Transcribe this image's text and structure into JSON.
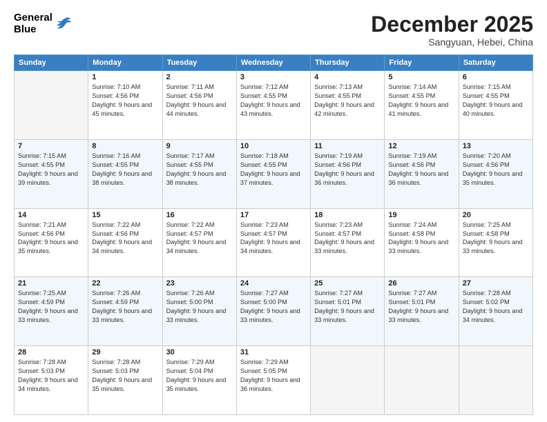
{
  "header": {
    "logo": {
      "general": "General",
      "blue": "Blue"
    },
    "title": "December 2025",
    "location": "Sangyuan, Hebei, China"
  },
  "days_of_week": [
    "Sunday",
    "Monday",
    "Tuesday",
    "Wednesday",
    "Thursday",
    "Friday",
    "Saturday"
  ],
  "weeks": [
    [
      {
        "day": "",
        "empty": true
      },
      {
        "day": "1",
        "sunrise": "Sunrise: 7:10 AM",
        "sunset": "Sunset: 4:56 PM",
        "daylight": "Daylight: 9 hours and 45 minutes."
      },
      {
        "day": "2",
        "sunrise": "Sunrise: 7:11 AM",
        "sunset": "Sunset: 4:56 PM",
        "daylight": "Daylight: 9 hours and 44 minutes."
      },
      {
        "day": "3",
        "sunrise": "Sunrise: 7:12 AM",
        "sunset": "Sunset: 4:55 PM",
        "daylight": "Daylight: 9 hours and 43 minutes."
      },
      {
        "day": "4",
        "sunrise": "Sunrise: 7:13 AM",
        "sunset": "Sunset: 4:55 PM",
        "daylight": "Daylight: 9 hours and 42 minutes."
      },
      {
        "day": "5",
        "sunrise": "Sunrise: 7:14 AM",
        "sunset": "Sunset: 4:55 PM",
        "daylight": "Daylight: 9 hours and 41 minutes."
      },
      {
        "day": "6",
        "sunrise": "Sunrise: 7:15 AM",
        "sunset": "Sunset: 4:55 PM",
        "daylight": "Daylight: 9 hours and 40 minutes."
      }
    ],
    [
      {
        "day": "7",
        "sunrise": "Sunrise: 7:15 AM",
        "sunset": "Sunset: 4:55 PM",
        "daylight": "Daylight: 9 hours and 39 minutes."
      },
      {
        "day": "8",
        "sunrise": "Sunrise: 7:16 AM",
        "sunset": "Sunset: 4:55 PM",
        "daylight": "Daylight: 9 hours and 38 minutes."
      },
      {
        "day": "9",
        "sunrise": "Sunrise: 7:17 AM",
        "sunset": "Sunset: 4:55 PM",
        "daylight": "Daylight: 9 hours and 38 minutes."
      },
      {
        "day": "10",
        "sunrise": "Sunrise: 7:18 AM",
        "sunset": "Sunset: 4:55 PM",
        "daylight": "Daylight: 9 hours and 37 minutes."
      },
      {
        "day": "11",
        "sunrise": "Sunrise: 7:19 AM",
        "sunset": "Sunset: 4:56 PM",
        "daylight": "Daylight: 9 hours and 36 minutes."
      },
      {
        "day": "12",
        "sunrise": "Sunrise: 7:19 AM",
        "sunset": "Sunset: 4:56 PM",
        "daylight": "Daylight: 9 hours and 36 minutes."
      },
      {
        "day": "13",
        "sunrise": "Sunrise: 7:20 AM",
        "sunset": "Sunset: 4:56 PM",
        "daylight": "Daylight: 9 hours and 35 minutes."
      }
    ],
    [
      {
        "day": "14",
        "sunrise": "Sunrise: 7:21 AM",
        "sunset": "Sunset: 4:56 PM",
        "daylight": "Daylight: 9 hours and 35 minutes."
      },
      {
        "day": "15",
        "sunrise": "Sunrise: 7:22 AM",
        "sunset": "Sunset: 4:56 PM",
        "daylight": "Daylight: 9 hours and 34 minutes."
      },
      {
        "day": "16",
        "sunrise": "Sunrise: 7:22 AM",
        "sunset": "Sunset: 4:57 PM",
        "daylight": "Daylight: 9 hours and 34 minutes."
      },
      {
        "day": "17",
        "sunrise": "Sunrise: 7:23 AM",
        "sunset": "Sunset: 4:57 PM",
        "daylight": "Daylight: 9 hours and 34 minutes."
      },
      {
        "day": "18",
        "sunrise": "Sunrise: 7:23 AM",
        "sunset": "Sunset: 4:57 PM",
        "daylight": "Daylight: 9 hours and 33 minutes."
      },
      {
        "day": "19",
        "sunrise": "Sunrise: 7:24 AM",
        "sunset": "Sunset: 4:58 PM",
        "daylight": "Daylight: 9 hours and 33 minutes."
      },
      {
        "day": "20",
        "sunrise": "Sunrise: 7:25 AM",
        "sunset": "Sunset: 4:58 PM",
        "daylight": "Daylight: 9 hours and 33 minutes."
      }
    ],
    [
      {
        "day": "21",
        "sunrise": "Sunrise: 7:25 AM",
        "sunset": "Sunset: 4:59 PM",
        "daylight": "Daylight: 9 hours and 33 minutes."
      },
      {
        "day": "22",
        "sunrise": "Sunrise: 7:26 AM",
        "sunset": "Sunset: 4:59 PM",
        "daylight": "Daylight: 9 hours and 33 minutes."
      },
      {
        "day": "23",
        "sunrise": "Sunrise: 7:26 AM",
        "sunset": "Sunset: 5:00 PM",
        "daylight": "Daylight: 9 hours and 33 minutes."
      },
      {
        "day": "24",
        "sunrise": "Sunrise: 7:27 AM",
        "sunset": "Sunset: 5:00 PM",
        "daylight": "Daylight: 9 hours and 33 minutes."
      },
      {
        "day": "25",
        "sunrise": "Sunrise: 7:27 AM",
        "sunset": "Sunset: 5:01 PM",
        "daylight": "Daylight: 9 hours and 33 minutes."
      },
      {
        "day": "26",
        "sunrise": "Sunrise: 7:27 AM",
        "sunset": "Sunset: 5:01 PM",
        "daylight": "Daylight: 9 hours and 33 minutes."
      },
      {
        "day": "27",
        "sunrise": "Sunrise: 7:28 AM",
        "sunset": "Sunset: 5:02 PM",
        "daylight": "Daylight: 9 hours and 34 minutes."
      }
    ],
    [
      {
        "day": "28",
        "sunrise": "Sunrise: 7:28 AM",
        "sunset": "Sunset: 5:03 PM",
        "daylight": "Daylight: 9 hours and 34 minutes."
      },
      {
        "day": "29",
        "sunrise": "Sunrise: 7:28 AM",
        "sunset": "Sunset: 5:03 PM",
        "daylight": "Daylight: 9 hours and 35 minutes."
      },
      {
        "day": "30",
        "sunrise": "Sunrise: 7:29 AM",
        "sunset": "Sunset: 5:04 PM",
        "daylight": "Daylight: 9 hours and 35 minutes."
      },
      {
        "day": "31",
        "sunrise": "Sunrise: 7:29 AM",
        "sunset": "Sunset: 5:05 PM",
        "daylight": "Daylight: 9 hours and 36 minutes."
      },
      {
        "day": "",
        "empty": true
      },
      {
        "day": "",
        "empty": true
      },
      {
        "day": "",
        "empty": true
      }
    ]
  ]
}
